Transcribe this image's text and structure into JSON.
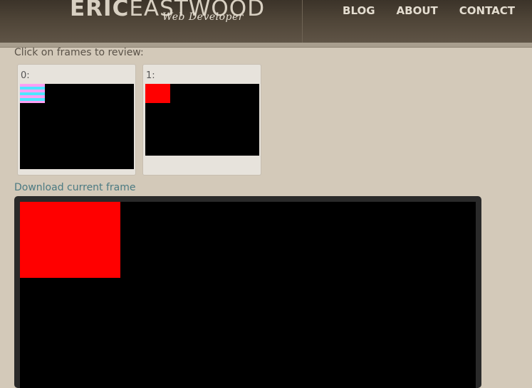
{
  "header": {
    "logo_first": "ERIC",
    "logo_last": "EASTWOOD",
    "logo_tagline": "Web Developer",
    "nav": [
      "BLOG",
      "ABOUT",
      "CONTACT"
    ]
  },
  "instructions": "Click on frames to review:",
  "frames": [
    {
      "label": "0:"
    },
    {
      "label": "1:"
    }
  ],
  "download_label": "Download current frame",
  "colors": {
    "page_bg": "#d3c9b9",
    "accent_link": "#4b7a82",
    "square": "#ff0000",
    "stripe_pink": "#ff9ff3",
    "stripe_cyan": "#4ee6ff"
  }
}
